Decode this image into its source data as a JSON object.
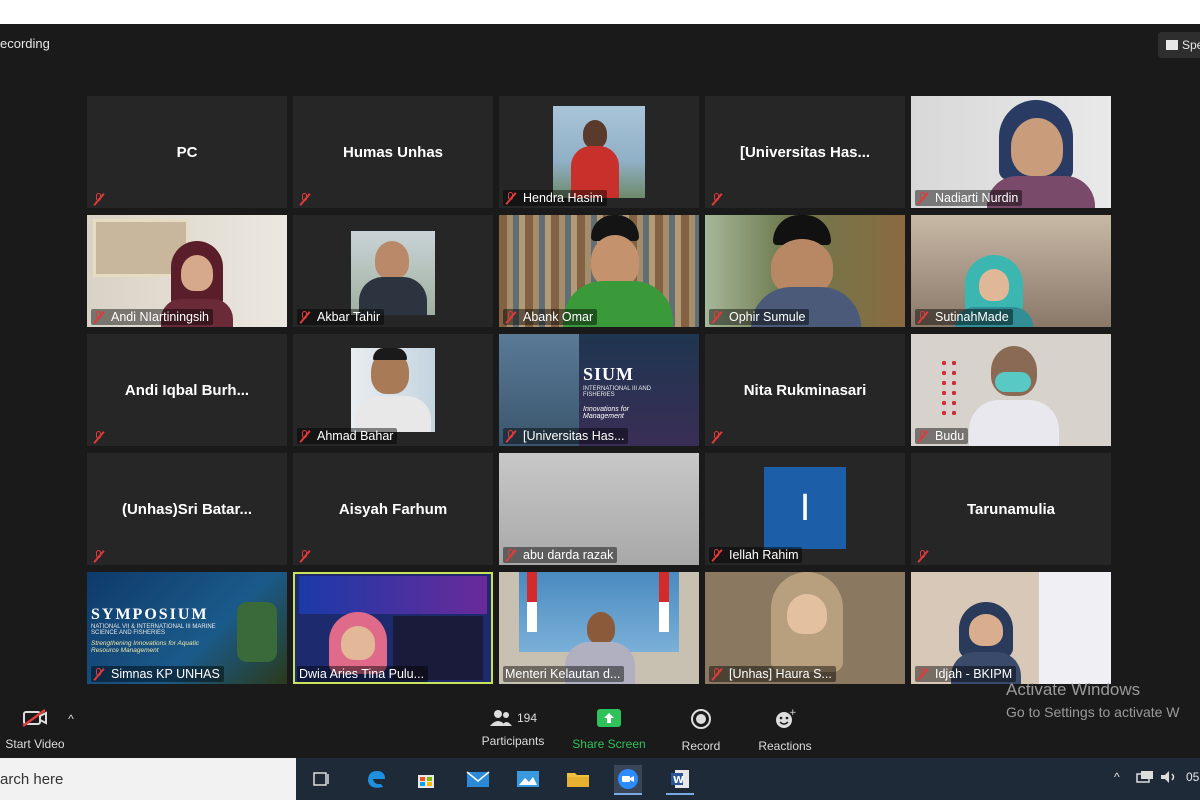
{
  "recording_label": "ecording",
  "speaker_view_label": "Spe",
  "tiles": [
    {
      "name": "PC",
      "kind": "text"
    },
    {
      "name": "Humas Unhas",
      "kind": "text"
    },
    {
      "name": "Hendra Hasim",
      "kind": "video"
    },
    {
      "name": "[Universitas Has...",
      "kind": "text"
    },
    {
      "name": "Nadiarti Nurdin",
      "kind": "video"
    },
    {
      "name": "Andi NIartiningsih",
      "kind": "video"
    },
    {
      "name": "Akbar Tahir",
      "kind": "video"
    },
    {
      "name": "Abank Omar",
      "kind": "video"
    },
    {
      "name": "Ophir Sumule",
      "kind": "video"
    },
    {
      "name": "SutinahMade",
      "kind": "video"
    },
    {
      "name": "Andi Iqbal Burh...",
      "kind": "text"
    },
    {
      "name": "Ahmad Bahar",
      "kind": "video"
    },
    {
      "name": "[Universitas Has...",
      "kind": "video"
    },
    {
      "name": "Nita Rukminasari",
      "kind": "text"
    },
    {
      "name": "Budu",
      "kind": "video"
    },
    {
      "name": "(Unhas)Sri Batar...",
      "kind": "text"
    },
    {
      "name": "Aisyah Farhum",
      "kind": "text"
    },
    {
      "name": "abu darda razak",
      "kind": "video"
    },
    {
      "name": "Iellah Rahim",
      "kind": "video"
    },
    {
      "name": "Tarunamulia",
      "kind": "text"
    },
    {
      "name": "Simnas KP UNHAS",
      "kind": "video"
    },
    {
      "name": "Dwia Aries Tina Pulu...",
      "kind": "video"
    },
    {
      "name": "Menteri Kelautan d...",
      "kind": "video"
    },
    {
      "name": "[Unhas] Haura S...",
      "kind": "video"
    },
    {
      "name": "Idjah - BKIPM",
      "kind": "video"
    }
  ],
  "poster_texts": {
    "symposium_big": "SIUM",
    "symposium_sub": "INTERNATIONAL III AND FISHERIES",
    "symposium_tag": "Innovations for Management",
    "simnas_title": "SYMPOSIUM",
    "simnas_sub": "NATIONAL VII & INTERNATIONAL III MARINE SCIENCE AND FISHERIES",
    "simnas_quote": "Strengthening Innovations for Aquatic Resource Management",
    "iellah_letter": "I"
  },
  "controls": {
    "start_video": "Start Video",
    "participants": "Participants",
    "participants_count": "194",
    "share_screen": "Share Screen",
    "record": "Record",
    "reactions": "Reactions"
  },
  "watermark": {
    "line1": "Activate Windows",
    "line2": "Go to Settings to activate W"
  },
  "taskbar": {
    "search_placeholder": "arch here",
    "clock": "05"
  },
  "colors": {
    "muted_mic": "#e03b3b",
    "share_green": "#2fc25b",
    "active_speaker": "#c9e35a",
    "zoom_bg": "#1a1a1a"
  }
}
